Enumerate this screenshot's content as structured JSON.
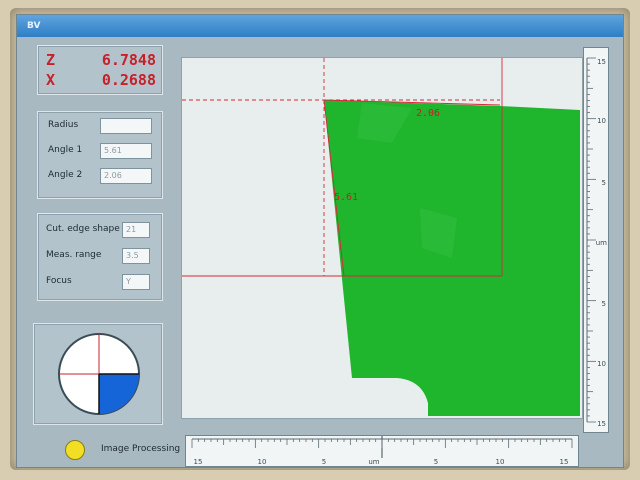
{
  "window": {
    "title": "BV"
  },
  "coords": {
    "z": {
      "axis": "Z",
      "value": "6.7848"
    },
    "x": {
      "axis": "X",
      "value": "0.2688"
    }
  },
  "geometry": {
    "radius": {
      "label": "Radius",
      "value": ""
    },
    "angle1": {
      "label": "Angle 1",
      "value": "5.61"
    },
    "angle2": {
      "label": "Angle 2",
      "value": "2.06"
    }
  },
  "measure": {
    "cut_edge_shape": {
      "label": "Cut. edge shape",
      "value": "21"
    },
    "meas_range": {
      "label": "Meas. range",
      "value": "3.5"
    },
    "focus": {
      "label": "Focus",
      "value": "Y"
    }
  },
  "overlay": {
    "angle_top": "2.06",
    "angle_side": "5.61"
  },
  "vscale": {
    "labels": [
      "15",
      "10",
      "5",
      "um",
      "5",
      "10",
      "15"
    ]
  },
  "hscale": {
    "labels": [
      "15",
      "10",
      "5",
      "um",
      "5",
      "10",
      "15"
    ]
  },
  "status": {
    "label": "Image Processing"
  },
  "colors": {
    "accent": "#c8202a",
    "tool_fill": "#1fb52d",
    "gauge_fill": "#1565d8",
    "led": "#f2df24"
  }
}
